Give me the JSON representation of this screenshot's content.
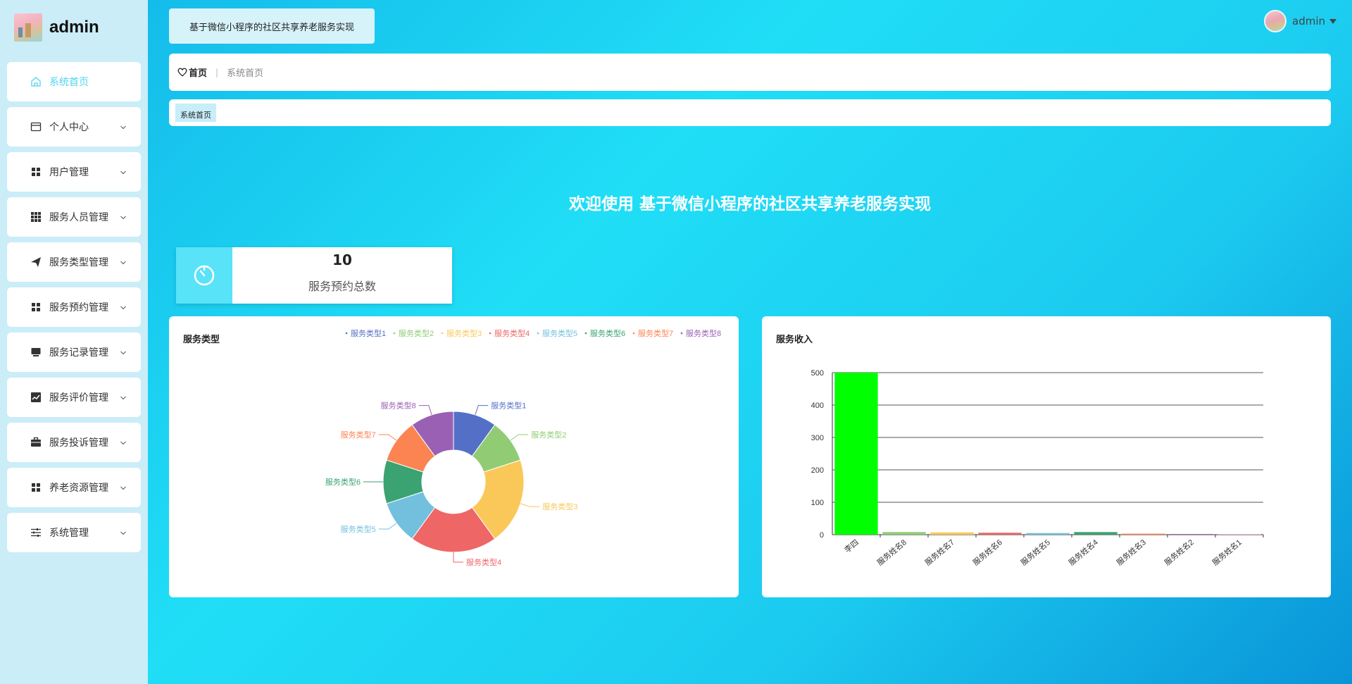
{
  "brand": {
    "name": "admin"
  },
  "sidebar": {
    "items": [
      {
        "label": "系统首页",
        "icon": "home-icon",
        "active": true
      },
      {
        "label": "个人中心",
        "icon": "card-icon"
      },
      {
        "label": "用户管理",
        "icon": "grid-icon"
      },
      {
        "label": "服务人员管理",
        "icon": "apps-icon"
      },
      {
        "label": "服务类型管理",
        "icon": "send-icon"
      },
      {
        "label": "服务预约管理",
        "icon": "grid-icon"
      },
      {
        "label": "服务记录管理",
        "icon": "monitor-icon"
      },
      {
        "label": "服务评价管理",
        "icon": "trend-icon"
      },
      {
        "label": "服务投诉管理",
        "icon": "briefcase-icon"
      },
      {
        "label": "养老资源管理",
        "icon": "grid-icon"
      },
      {
        "label": "系统管理",
        "icon": "sliders-icon"
      }
    ]
  },
  "header": {
    "title": "基于微信小程序的社区共享养老服务实现",
    "user": "admin"
  },
  "breadcrumb": {
    "home": "首页",
    "separator": "|",
    "current": "系统首页"
  },
  "tags": [
    "系统首页"
  ],
  "welcome": "欢迎使用 基于微信小程序的社区共享养老服务实现",
  "stat": {
    "value": "10",
    "label": "服务预约总数"
  },
  "colors": {
    "accent": "#4fd5ee",
    "pie": [
      "#5470c6",
      "#91cc75",
      "#fac858",
      "#ee6666",
      "#73c0de",
      "#3ba272",
      "#fc8452",
      "#9a60b4"
    ],
    "bar": [
      "#00ff00",
      "#91cc75",
      "#fac858",
      "#ee6666",
      "#73c0de",
      "#3ba272",
      "#fc8452",
      "#9a60b4",
      "#ea7ccc"
    ]
  },
  "chart_data": [
    {
      "type": "pie",
      "title": "服务类型",
      "legend_position": "top-right",
      "categories": [
        "服务类型1",
        "服务类型2",
        "服务类型3",
        "服务类型4",
        "服务类型5",
        "服务类型6",
        "服务类型7",
        "服务类型8"
      ],
      "values": [
        1,
        1,
        2,
        2,
        1,
        1,
        1,
        1
      ]
    },
    {
      "type": "bar",
      "title": "服务收入",
      "categories": [
        "李四",
        "服务姓名8",
        "服务姓名7",
        "服务姓名6",
        "服务姓名5",
        "服务姓名4",
        "服务姓名3",
        "服务姓名2",
        "服务姓名1"
      ],
      "values": [
        500,
        8,
        7,
        6,
        5,
        8,
        3,
        2,
        1
      ],
      "ylim": [
        0,
        500
      ],
      "yticks": [
        0,
        100,
        200,
        300,
        400,
        500
      ],
      "grid": true
    }
  ]
}
